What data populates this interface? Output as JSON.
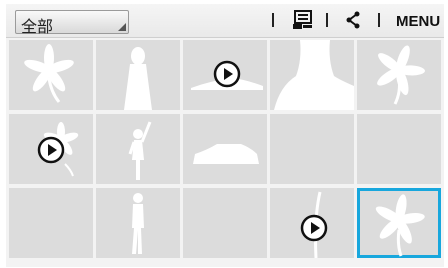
{
  "topbar": {
    "filter_label": "全部",
    "menu_label": "MENU",
    "icons": [
      "slideshow-icon",
      "share-icon"
    ]
  },
  "grid": {
    "rows": 3,
    "columns": 5,
    "tiles": [
      {
        "content": "flower",
        "video": false
      },
      {
        "content": "person-silhouette",
        "video": false
      },
      {
        "content": "landscape",
        "video": true
      },
      {
        "content": "portrait-silhouette",
        "video": false
      },
      {
        "content": "flower",
        "video": false
      },
      {
        "content": "flower",
        "video": true
      },
      {
        "content": "person-waving",
        "video": false
      },
      {
        "content": "car",
        "video": false
      },
      {
        "content": "blank",
        "video": false
      },
      {
        "content": "blank",
        "video": false
      },
      {
        "content": "blank",
        "video": false
      },
      {
        "content": "person-standing",
        "video": false
      },
      {
        "content": "blank",
        "video": false
      },
      {
        "content": "plant",
        "video": true
      },
      {
        "content": "flower",
        "video": false,
        "selected": true
      }
    ]
  },
  "colors": {
    "tile": "#dcdcdc",
    "silhouette": "#ffffff",
    "selection": "#18a7dd",
    "play_icon": "#111111"
  }
}
